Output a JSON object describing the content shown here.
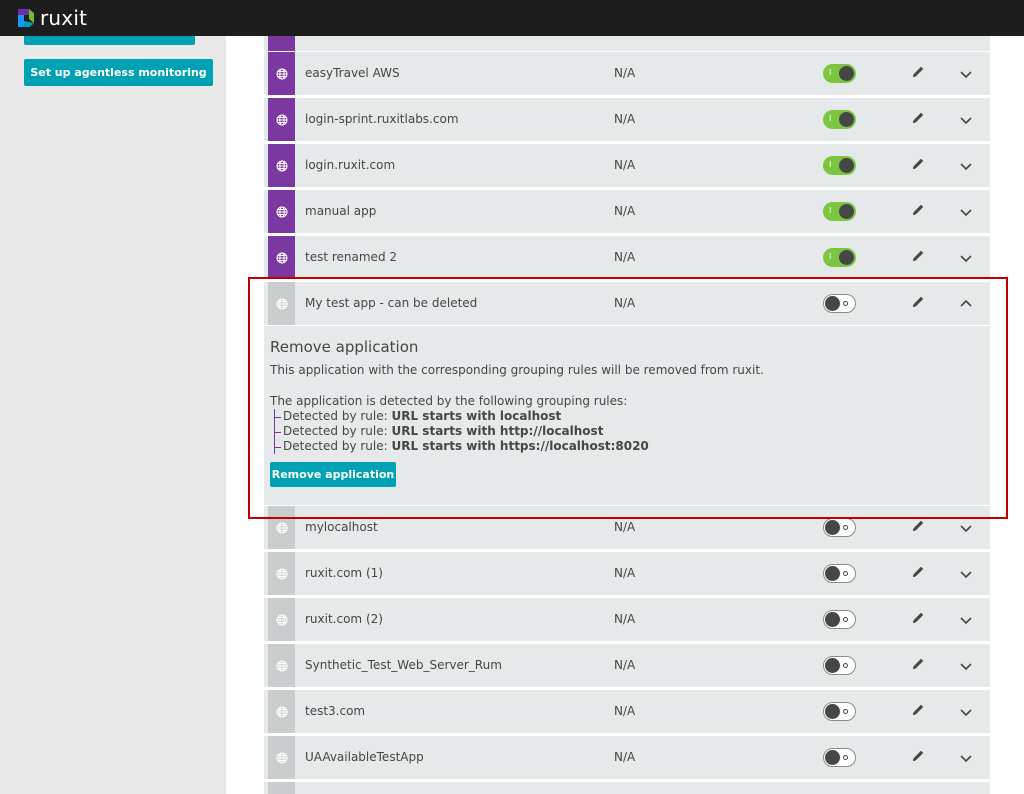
{
  "app": {
    "name": "ruxit"
  },
  "sidebar": {
    "setup_button": "Set up agentless monitoring"
  },
  "apps": [
    {
      "name": "easyTravel AWS",
      "apdex": "N/A",
      "enabled": true
    },
    {
      "name": "login-sprint.ruxitlabs.com",
      "apdex": "N/A",
      "enabled": true
    },
    {
      "name": "login.ruxit.com",
      "apdex": "N/A",
      "enabled": true
    },
    {
      "name": "manual app",
      "apdex": "N/A",
      "enabled": true
    },
    {
      "name": "test renamed 2",
      "apdex": "N/A",
      "enabled": true
    },
    {
      "name": "My test app - can be deleted",
      "apdex": "N/A",
      "enabled": false,
      "expanded": true
    },
    {
      "name": "mylocalhost",
      "apdex": "N/A",
      "enabled": false
    },
    {
      "name": "ruxit.com (1)",
      "apdex": "N/A",
      "enabled": false
    },
    {
      "name": "ruxit.com (2)",
      "apdex": "N/A",
      "enabled": false
    },
    {
      "name": "Synthetic_Test_Web_Server_Rum",
      "apdex": "N/A",
      "enabled": false
    },
    {
      "name": "test3.com",
      "apdex": "N/A",
      "enabled": false
    },
    {
      "name": "UAAvailableTestApp",
      "apdex": "N/A",
      "enabled": false
    }
  ],
  "toggle_on_mark": "I",
  "remove_panel": {
    "title": "Remove application",
    "description": "This application with the corresponding grouping rules will be removed from ruxit.",
    "rules_intro": "The application is detected by the following grouping rules:",
    "rule_prefix": "Detected by rule:",
    "rules": [
      "URL starts with localhost",
      "URL starts with http://localhost",
      "URL starts with https://localhost:8020"
    ],
    "button": "Remove application"
  },
  "colors": {
    "accent": "#00a1b2",
    "enabled_icon": "#7c38a1",
    "toggle_on": "#7dc540",
    "highlight": "#c00000"
  },
  "icons": {
    "app_icon": "globe-icon",
    "edit": "pencil-icon",
    "expand": "chevron-down-icon",
    "collapse": "chevron-up-icon"
  }
}
